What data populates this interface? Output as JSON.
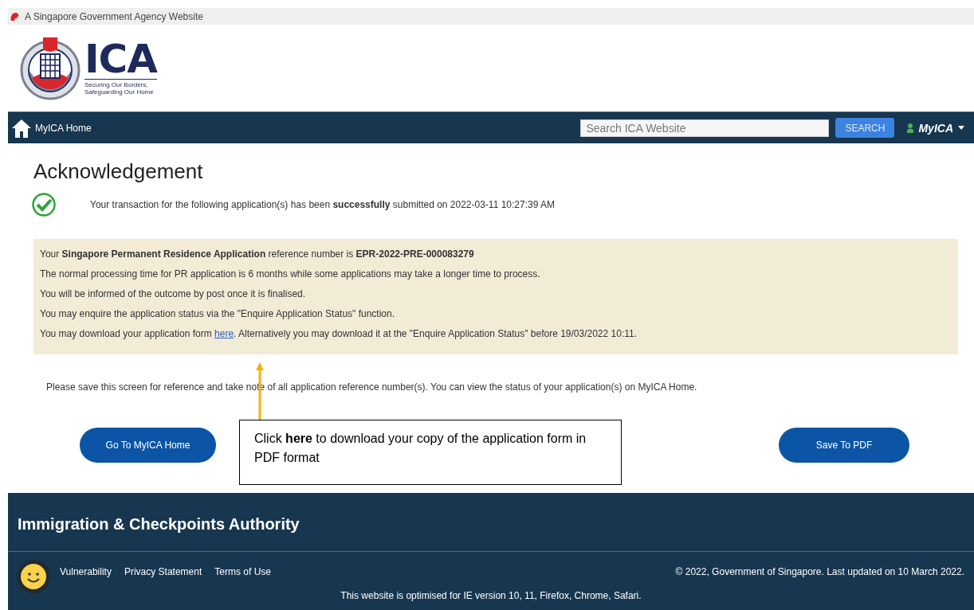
{
  "masthead": {
    "text": "A Singapore Government Agency Website"
  },
  "logo": {
    "name": "ICA",
    "tagline_lines": [
      "Securing Our Borders,",
      "Safeguarding Our Home"
    ]
  },
  "nav": {
    "home_link": "MyICA Home",
    "search": {
      "placeholder": "Search ICA Website"
    },
    "search_button": "SEARCH",
    "account_menu": "MyICA"
  },
  "page": {
    "title": "Acknowledgement",
    "status_message": "Your transaction for the following application(s) has been **successfully** submitted on 2022-03-11 10:27:39 AM",
    "details": [
      {
        "kind": "text",
        "text": "Your **Singapore Permanent Residence Application** reference number is **EPR-2022-PRE-000083279**"
      },
      {
        "kind": "text",
        "text": "The normal processing time for PR application is 6 months while some applications may take a longer time to process."
      },
      {
        "kind": "text",
        "text": "You will be informed of the outcome by post once it is finalised."
      },
      {
        "kind": "text",
        "text": "You may enquire the application status via the \"Enquire Application Status\" function."
      },
      {
        "kind": "link",
        "text": "You may download your application form ",
        "link": "here",
        "after": ". Alternatively you may download it at the \"Enquire Application Status\" before 19/03/2022 10:11."
      }
    ],
    "note": "Please save this screen for reference and take note of all application reference number(s). You can view the status of your application(s) on MyICA Home.",
    "buttons": [
      "Go To MyICA Home",
      "Save To PDF"
    ]
  },
  "callout": {
    "text": "Click **here** to download your copy of the application form in PDF format"
  },
  "footer": {
    "title": "Immigration & Checkpoints Authority",
    "links": [
      "Vulnerability",
      "Privacy Statement",
      "Terms of Use"
    ],
    "copyright": "© 2022, Government of Singapore. Last updated on 10 March 2022.",
    "browser_note": "This website is optimised for IE version 10, 11, Firefox, Chrome, Safari."
  }
}
